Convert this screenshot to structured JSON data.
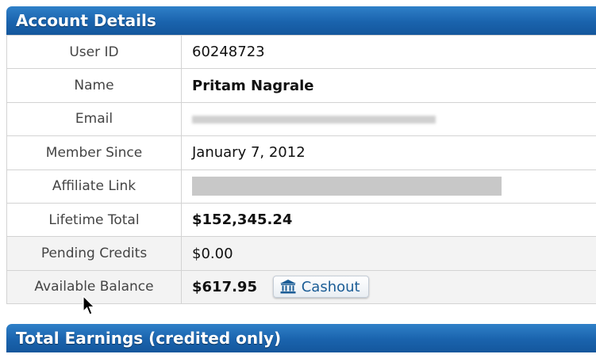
{
  "account_details": {
    "title": "Account Details",
    "rows": [
      {
        "label": "User ID",
        "value": "60248723"
      },
      {
        "label": "Name",
        "value": "Pritam Nagrale"
      },
      {
        "label": "Email",
        "value": ""
      },
      {
        "label": "Member Since",
        "value": "January 7, 2012"
      },
      {
        "label": "Affiliate Link",
        "value": ""
      },
      {
        "label": "Lifetime Total",
        "value": "$152,345.24"
      },
      {
        "label": "Pending Credits",
        "value": "$0.00"
      },
      {
        "label": "Available Balance",
        "value": "$617.95"
      }
    ],
    "cashout_label": "Cashout",
    "cashout_icon": "bank-icon"
  },
  "total_earnings": {
    "title": "Total Earnings (credited only)"
  },
  "colors": {
    "header_blue": "#1a63ad",
    "link_blue": "#1b5d96",
    "border_gray": "#d3d3d3"
  }
}
